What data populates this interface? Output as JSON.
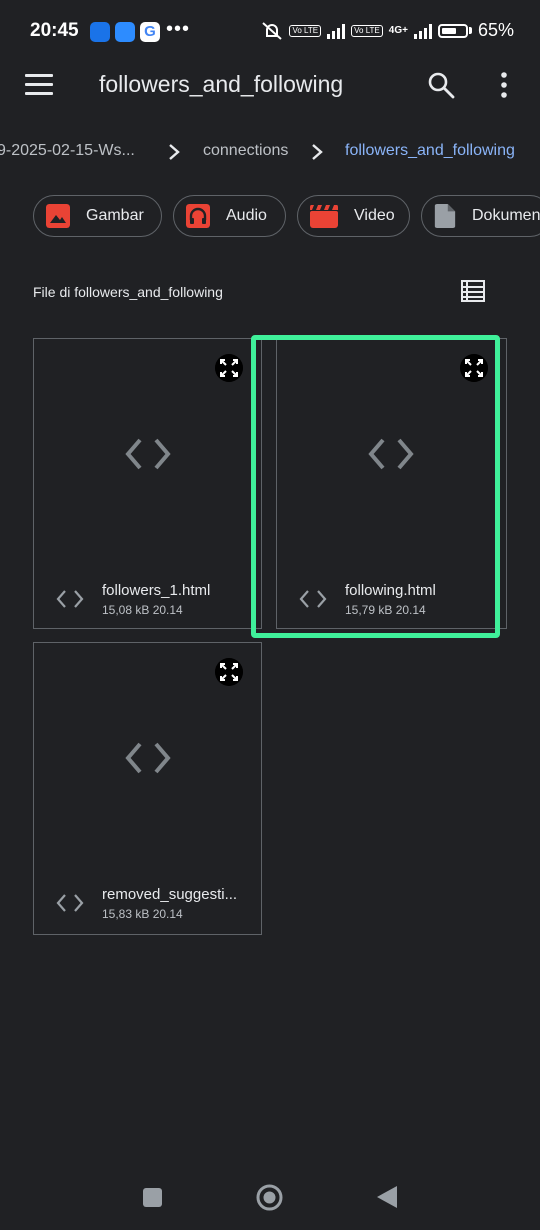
{
  "status_bar": {
    "time": "20:45",
    "overflow_dots": "•••",
    "notification_icons": [
      "messages-icon",
      "chat-icon",
      "google-icon"
    ],
    "google_letter": "G",
    "volte_badge_1": "Vo LTE",
    "volte_badge_2": "Vo LTE",
    "network": "4G+",
    "battery_level": 65,
    "battery_text": "65%"
  },
  "app_bar": {
    "title": "followers_and_following"
  },
  "breadcrumbs": [
    {
      "label": "9-2025-02-15-Ws..."
    },
    {
      "label": "connections"
    },
    {
      "label": "followers_and_following"
    }
  ],
  "chips": [
    {
      "label": "Gambar",
      "icon": "image-icon",
      "color": "#ea4335"
    },
    {
      "label": "Audio",
      "icon": "headphones-icon",
      "color": "#ea4335"
    },
    {
      "label": "Video",
      "icon": "clapperboard-icon",
      "color": "#ea4335"
    },
    {
      "label": "Dokumen",
      "icon": "document-icon",
      "color": "#9aa0a6"
    }
  ],
  "section": {
    "label": "File di followers_and_following"
  },
  "files": [
    {
      "name": "followers_1.html",
      "meta": "15,08 kB  20.14"
    },
    {
      "name": "following.html",
      "meta": "15,79 kB  20.14",
      "highlighted": true
    },
    {
      "name": "removed_suggesti...",
      "meta": "15,83 kB  20.14"
    }
  ],
  "colors": {
    "background": "#202124",
    "accent_link": "#8ab4f8",
    "highlight": "#3ff09a"
  }
}
